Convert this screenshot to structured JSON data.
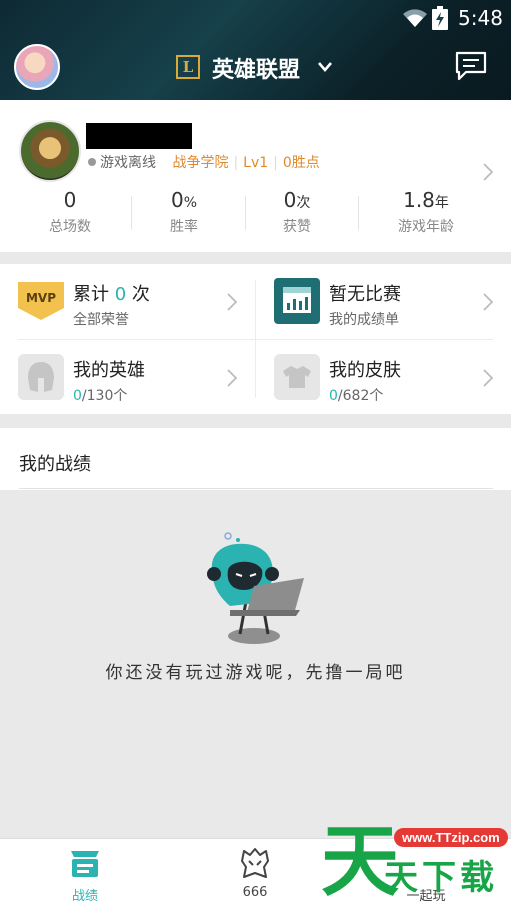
{
  "status_bar": {
    "time": "5:48"
  },
  "header": {
    "game_logo_letter": "L",
    "game_title": "英雄联盟",
    "accent_color": "#d9a93a"
  },
  "profile": {
    "status": "游戏离线",
    "region": "战争学院",
    "level": "Lv1",
    "points": "0胜点",
    "stats": [
      {
        "value": "0",
        "unit": "",
        "label": "总场数"
      },
      {
        "value": "0",
        "unit": "%",
        "label": "胜率"
      },
      {
        "value": "0",
        "unit": "次",
        "label": "获赞"
      },
      {
        "value": "1.8",
        "unit": "年",
        "label": "游戏年龄"
      }
    ]
  },
  "grid": {
    "honor": {
      "badge": "MVP",
      "prefix": "累计",
      "count": "0",
      "suffix": "次",
      "sub": "全部荣誉"
    },
    "match": {
      "title": "暂无比赛",
      "sub": "我的成绩单"
    },
    "heroes": {
      "title": "我的英雄",
      "count": "0",
      "total": "/130个"
    },
    "skins": {
      "title": "我的皮肤",
      "count": "0",
      "total": "/682个"
    }
  },
  "record": {
    "title": "我的战绩",
    "empty_text": "你还没有玩过游戏呢，先撸一局吧"
  },
  "bottom_nav": {
    "tabs": [
      {
        "label": "战绩",
        "icon": "record-tab-icon",
        "active": true
      },
      {
        "label": "666",
        "icon": "helmet-tab-icon",
        "active": false
      },
      {
        "label": "一起玩",
        "icon": "play-together-tab-icon",
        "active": false
      }
    ],
    "active_color": "#2bb3b1"
  },
  "watermark": {
    "url": "www.TTzip.com",
    "text": "天下载",
    "big_char": "天"
  }
}
